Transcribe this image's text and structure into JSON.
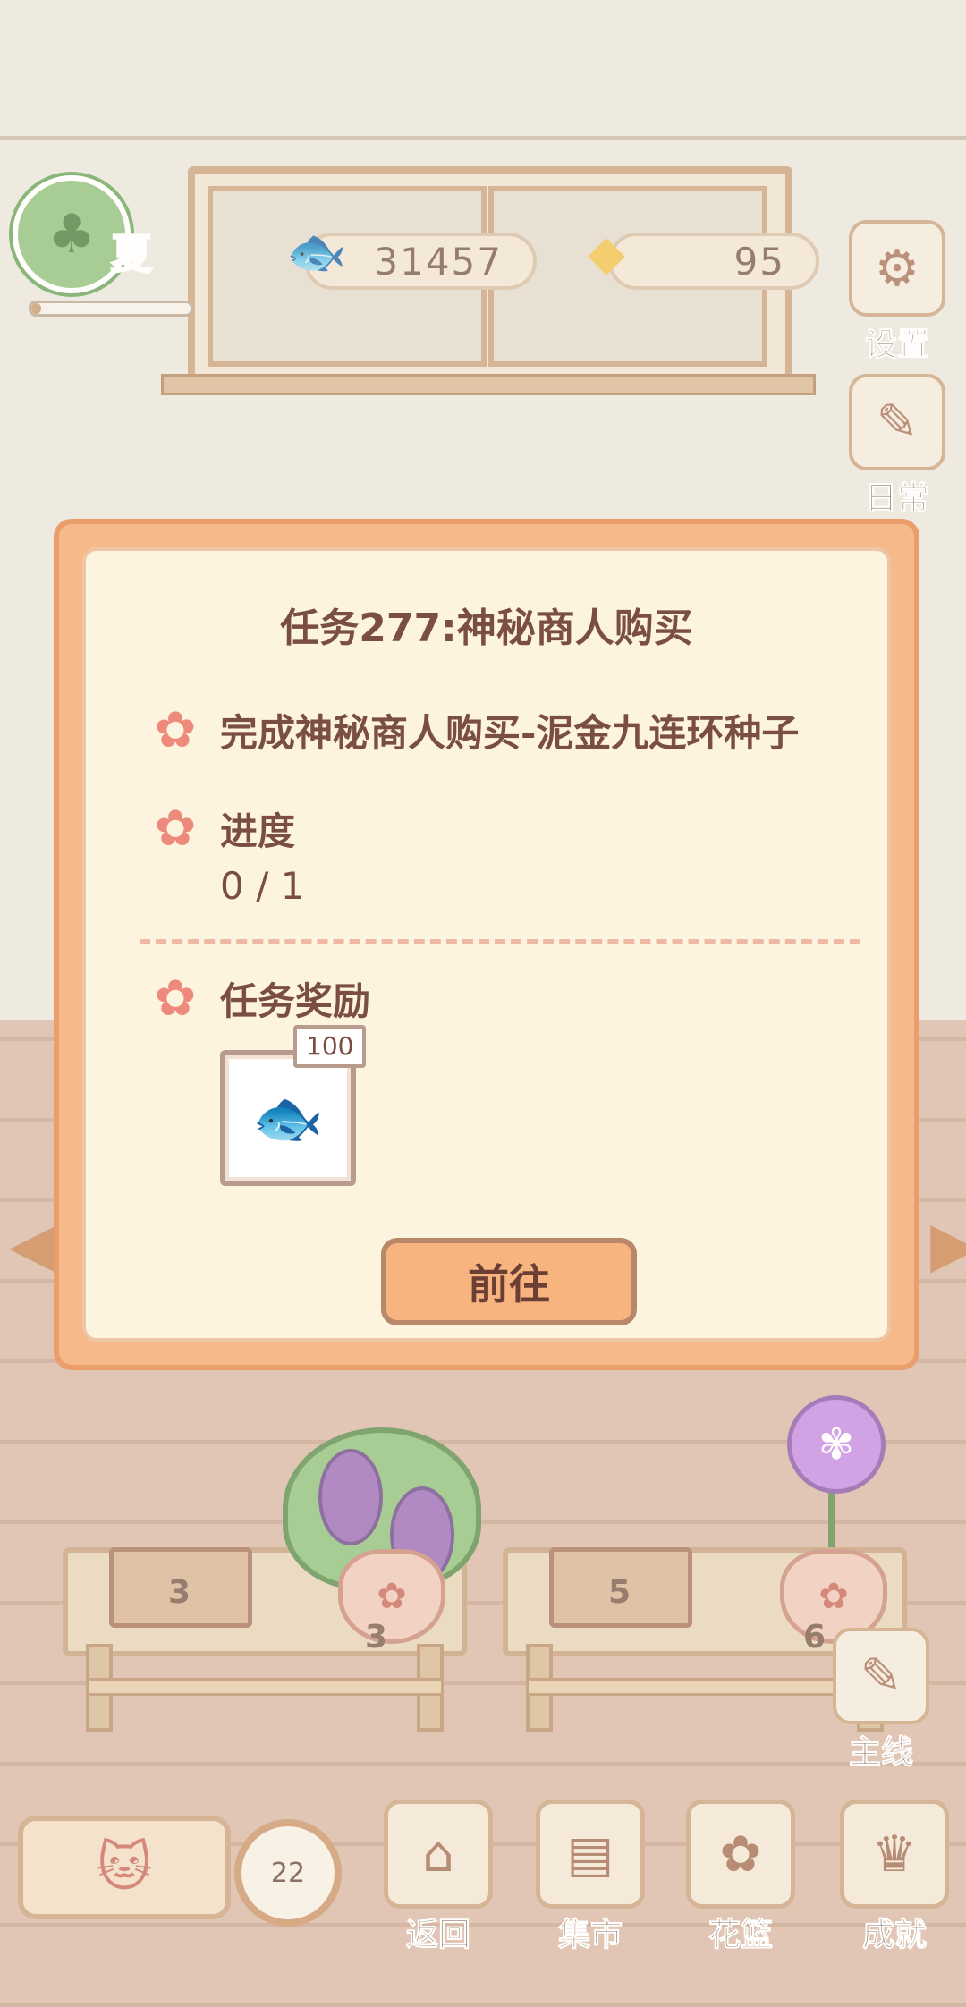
{
  "hud": {
    "season": "夏",
    "fish_coins": "31457",
    "cheese": "95"
  },
  "side_menu": {
    "settings": "设置",
    "daily": "日常",
    "main_quest": "主线"
  },
  "shelves": {
    "counts": [
      "3",
      "3",
      "5",
      "6"
    ]
  },
  "bottom_nav": {
    "timer": "22",
    "back": "返回",
    "market": "集市",
    "basket": "花篮",
    "achievements": "成就"
  },
  "dialog": {
    "title": "任务277:神秘商人购买",
    "task_text": "完成神秘商人购买-泥金九连环种子",
    "progress_label": "进度",
    "progress_value": "0 / 1",
    "progress_fraction": 0,
    "reward_label": "任务奖励",
    "reward_qty": "100",
    "reward_icon": "fish-bone-icon",
    "goto_button": "前往"
  },
  "colors": {
    "dialog_border": "#f6b98a",
    "dialog_body": "#fdf4e0",
    "text_brown": "#7b4e45",
    "flower_pink": "#ee8a7c",
    "button_orange": "#f7b47f"
  }
}
